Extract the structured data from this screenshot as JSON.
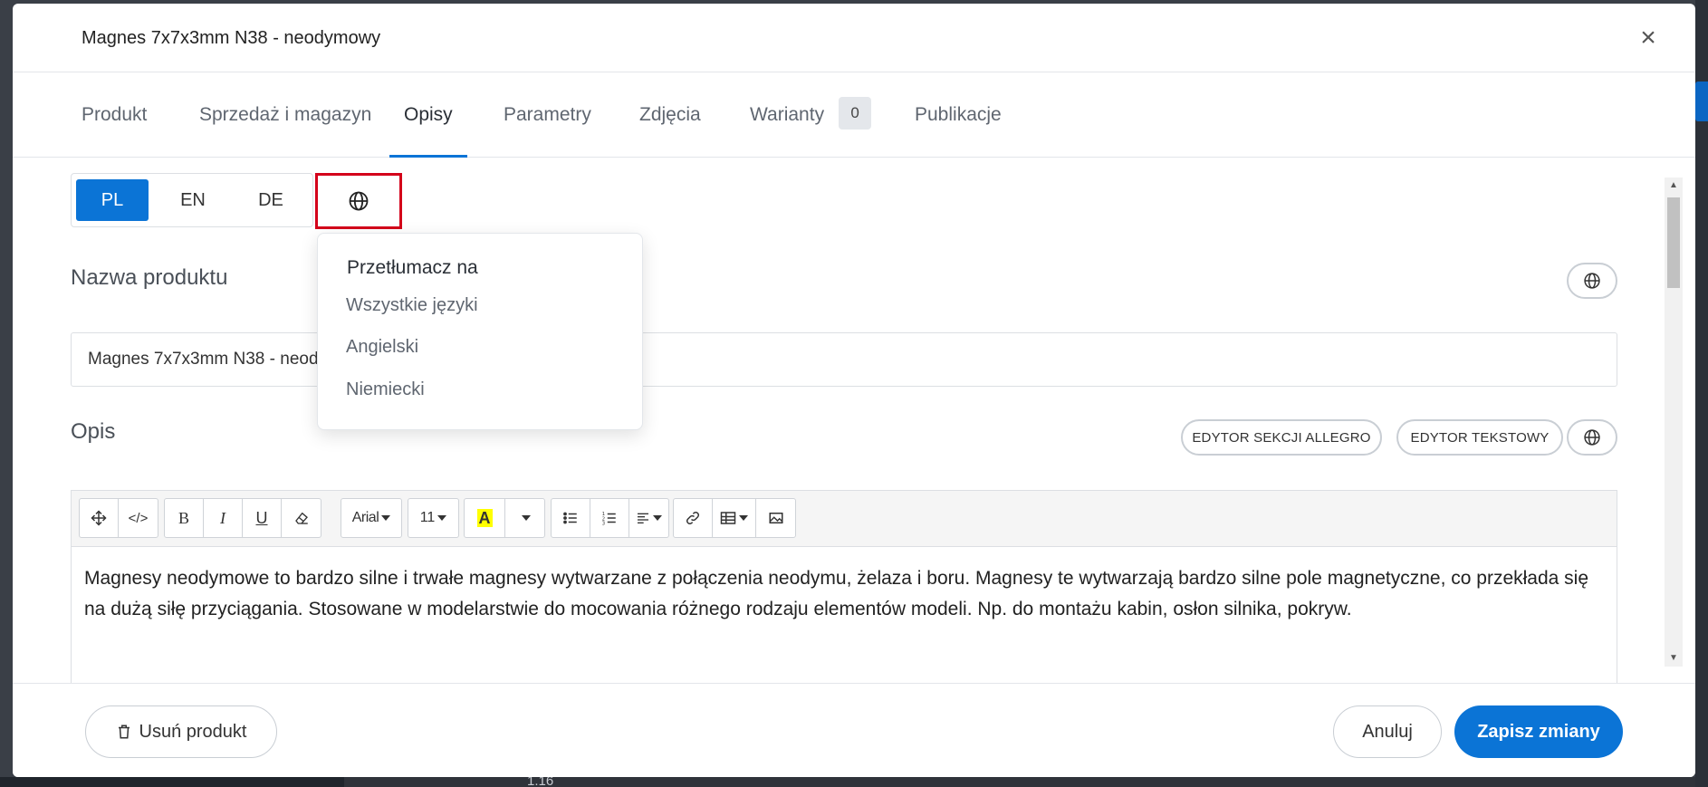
{
  "modal": {
    "title": "Magnes 7x7x3mm N38 - neodymowy",
    "close_label": "×"
  },
  "tabs": [
    {
      "label": "Produkt"
    },
    {
      "label": "Sprzedaż i magazyn"
    },
    {
      "label": "Opisy",
      "active": true
    },
    {
      "label": "Parametry"
    },
    {
      "label": "Zdjęcia"
    },
    {
      "label": "Warianty",
      "badge": "0"
    },
    {
      "label": "Publikacje"
    }
  ],
  "languages": {
    "items": [
      "PL",
      "EN",
      "DE"
    ],
    "active": "PL"
  },
  "translate_dropdown": {
    "header": "Przetłumacz na",
    "items": [
      "Wszystkie języki",
      "Angielski",
      "Niemiecki"
    ]
  },
  "product_name": {
    "label": "Nazwa produktu",
    "value": "Magnes 7x7x3mm N38 - neodymowy"
  },
  "description": {
    "label": "Opis",
    "allegro_button": "EDYTOR SEKCJI ALLEGRO",
    "text_button": "EDYTOR TEKSTOWY",
    "toolbar": {
      "font": "Arial",
      "size": "11",
      "color_letter": "A"
    },
    "text": "Magnesy neodymowe to bardzo silne i trwałe magnesy wytwarzane z połączenia neodymu, żelaza i boru. Magnesy te wytwarzają bardzo silne pole magnetyczne, co przekłada się na dużą siłę przyciągania. Stosowane w modelarstwie do mocowania różnego rodzaju elementów modeli. Np. do montażu kabin, osłon silnika, pokryw."
  },
  "footer": {
    "delete_label": "Usuń produkt",
    "cancel_label": "Anuluj",
    "save_label": "Zapisz zmiany"
  },
  "background": {
    "peek_text": "1.16"
  },
  "colors": {
    "accent": "#0b74d6",
    "highlight_border": "#d4001a",
    "font_color_highlight": "#ffff00"
  }
}
